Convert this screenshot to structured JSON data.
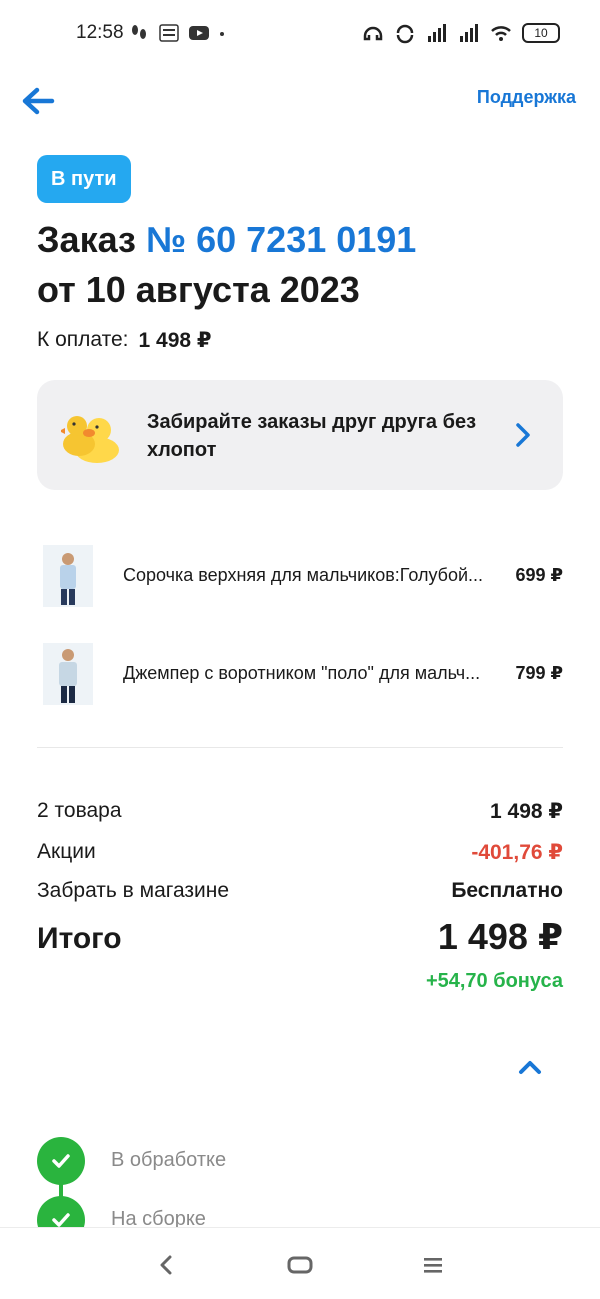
{
  "status_bar": {
    "time": "12:58",
    "battery": "10"
  },
  "header": {
    "support_label": "Поддержка"
  },
  "order": {
    "status": "В пути",
    "title_prefix": "Заказ",
    "number": "№ 60 7231 0191",
    "date": "от 10 августа 2023",
    "pay_label": "К оплате:",
    "pay_amount": "1 498 ₽"
  },
  "promo": {
    "text": "Забирайте заказы друг друга без хлопот"
  },
  "products": [
    {
      "name": "Сорочка верхняя для мальчиков:Голубой...",
      "price": "699 ₽"
    },
    {
      "name": "Джемпер с воротником \"поло\" для мальч...",
      "price": "799 ₽"
    }
  ],
  "summary": {
    "items_label": "2 товара",
    "items_value": "1 498 ₽",
    "promo_label": "Акции",
    "promo_value": "-401,76 ₽",
    "pickup_label": "Забрать в магазине",
    "pickup_value": "Бесплатно",
    "total_label": "Итого",
    "total_value": "1 498 ₽",
    "bonus": "+54,70 бонуса"
  },
  "timeline": [
    {
      "label": "В обработке"
    },
    {
      "label": "На сборке"
    }
  ],
  "colors": {
    "accent": "#1877d6",
    "status_pill": "#25a8f0",
    "success": "#2ab43e",
    "discount": "#e04a3a"
  }
}
